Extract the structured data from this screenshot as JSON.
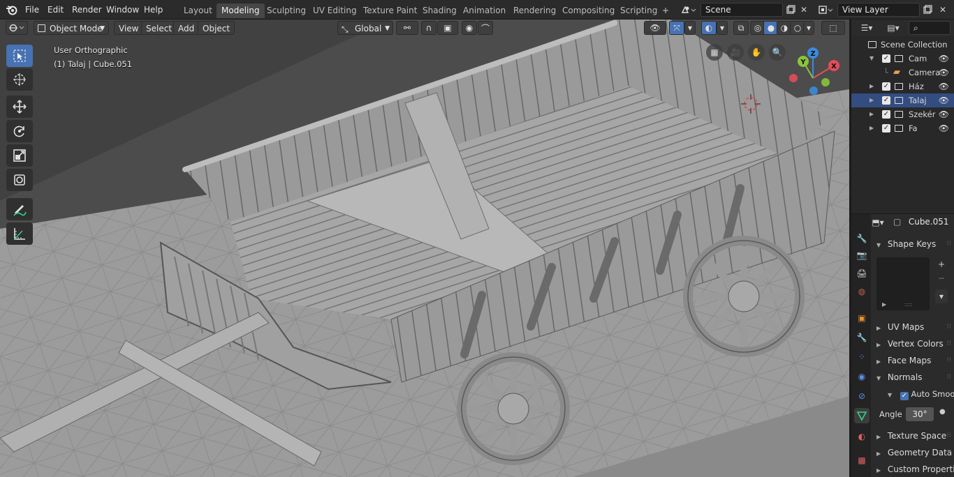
{
  "menu": [
    "File",
    "Edit",
    "Render",
    "Window",
    "Help"
  ],
  "workspaces": [
    "Layout",
    "Modeling",
    "Sculpting",
    "UV Editing",
    "Texture Paint",
    "Shading",
    "Animation",
    "Rendering",
    "Compositing",
    "Scripting"
  ],
  "active_workspace": "Modeling",
  "scene_field": "Scene",
  "view_layer_field": "View Layer",
  "viewport_header": {
    "mode": "Object Mode",
    "view": "View",
    "select": "Select",
    "add": "Add",
    "object": "Object",
    "orientation": "Global"
  },
  "viewport_overlay": {
    "view_name": "User Orthographic",
    "object_info": "(1) Talaj | Cube.051"
  },
  "gizmo_axes": {
    "x": "X",
    "y": "Y",
    "z": "Z"
  },
  "outliner": {
    "root": "Scene Collection",
    "items": [
      {
        "label": "Cam",
        "type": "collection",
        "expanded": true
      },
      {
        "label": "Camera",
        "type": "camera"
      },
      {
        "label": "Ház",
        "type": "collection"
      },
      {
        "label": "Talaj",
        "type": "collection",
        "selected": true
      },
      {
        "label": "Szekér",
        "type": "collection"
      },
      {
        "label": "Fa",
        "type": "collection"
      }
    ]
  },
  "properties": {
    "object_name": "Cube.051",
    "panels": {
      "shape_keys": "Shape Keys",
      "uv_maps": "UV Maps",
      "vertex_colors": "Vertex Colors",
      "face_maps": "Face Maps",
      "normals": "Normals",
      "auto_smooth": "Auto Smooth",
      "angle_label": "Angle",
      "angle_value": "30°",
      "texture_space": "Texture Space",
      "geometry_data": "Geometry Data",
      "custom_properties": "Custom Properties"
    },
    "auto_smooth_checked": true
  },
  "colors": {
    "accent": "#4772b3",
    "axis_x": "#e54d58",
    "axis_y": "#8ac43a",
    "axis_z": "#3b8bde",
    "data_tab": "#33d48a"
  }
}
